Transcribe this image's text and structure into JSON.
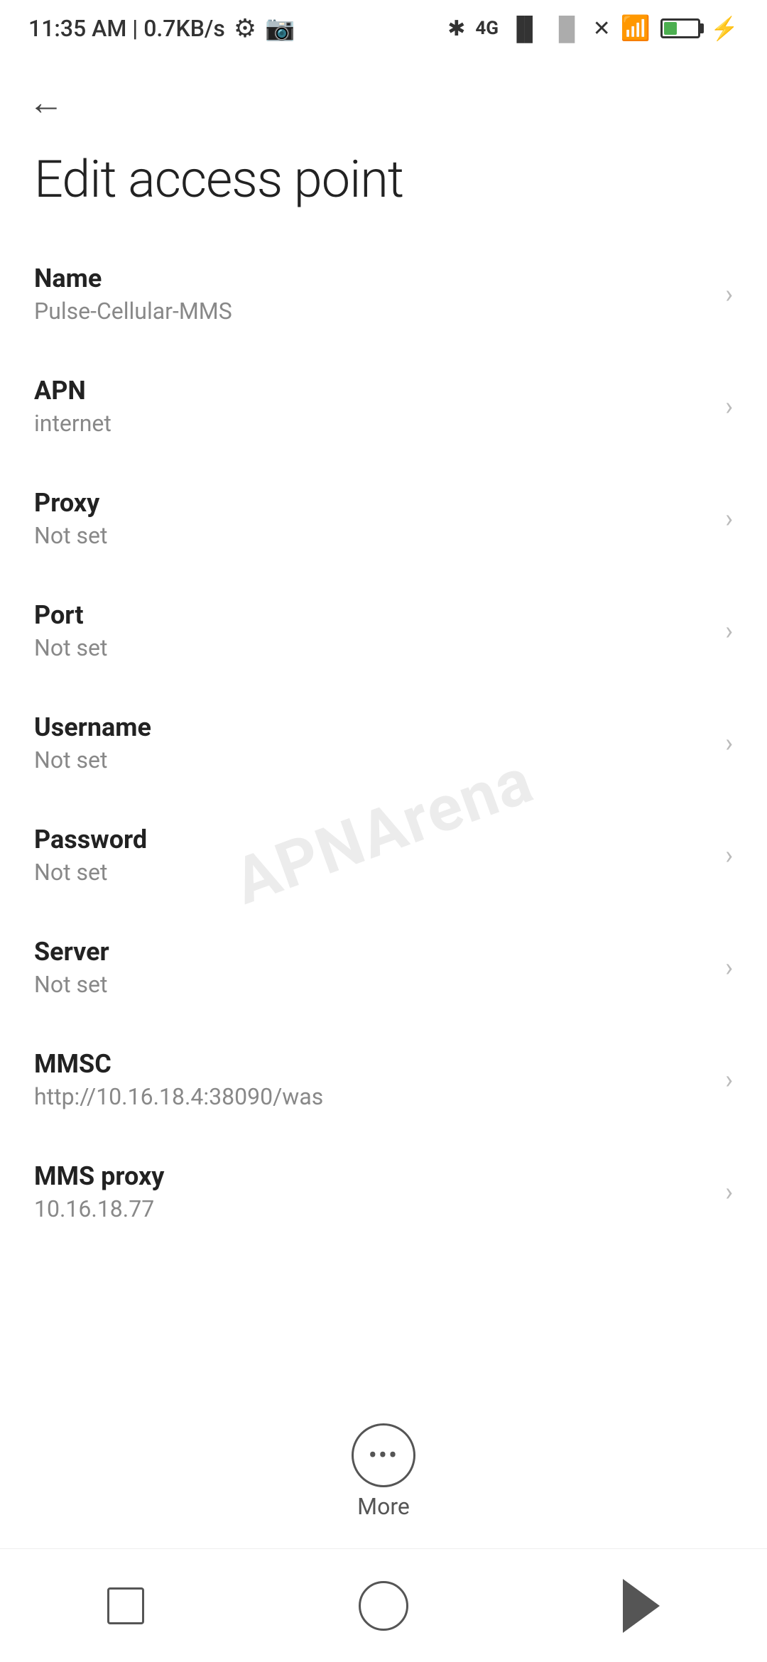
{
  "statusBar": {
    "time": "11:35 AM | 0.7KB/s",
    "batteryPercent": "38"
  },
  "page": {
    "title": "Edit access point",
    "backLabel": "Back"
  },
  "settings": [
    {
      "label": "Name",
      "value": "Pulse-Cellular-MMS"
    },
    {
      "label": "APN",
      "value": "internet"
    },
    {
      "label": "Proxy",
      "value": "Not set"
    },
    {
      "label": "Port",
      "value": "Not set"
    },
    {
      "label": "Username",
      "value": "Not set"
    },
    {
      "label": "Password",
      "value": "Not set"
    },
    {
      "label": "Server",
      "value": "Not set"
    },
    {
      "label": "MMSC",
      "value": "http://10.16.18.4:38090/was"
    },
    {
      "label": "MMS proxy",
      "value": "10.16.18.77"
    }
  ],
  "moreButton": {
    "label": "More"
  },
  "watermark": {
    "text": "APNArena"
  }
}
